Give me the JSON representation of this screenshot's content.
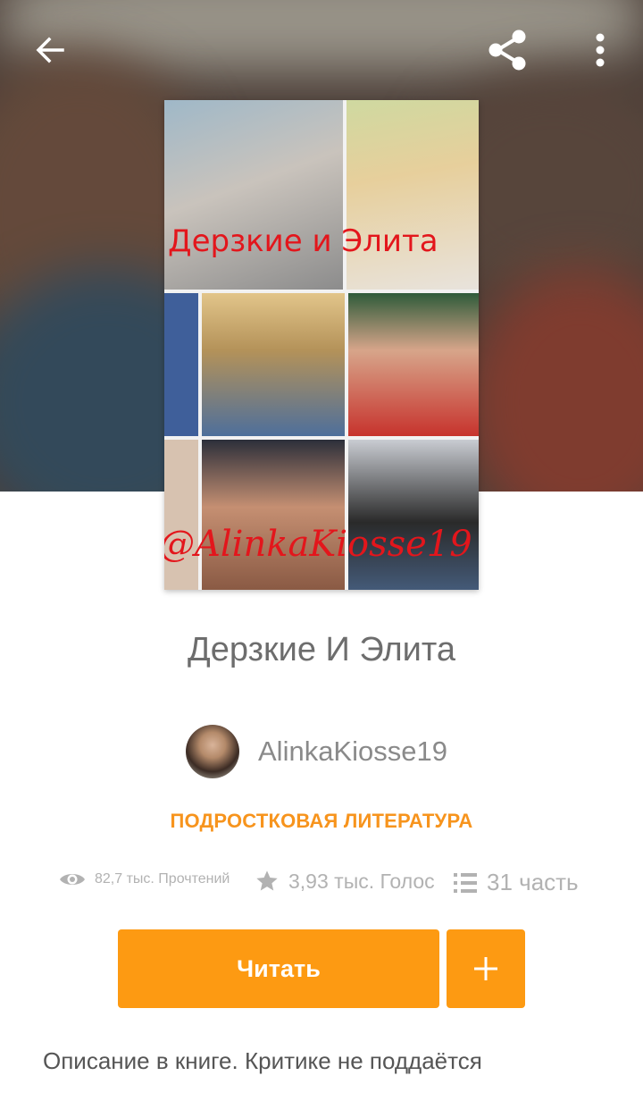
{
  "header": {
    "back_icon": "arrow-left-icon",
    "share_icon": "share-icon",
    "more_icon": "more-vertical-icon"
  },
  "cover": {
    "title_text": "Дерзкие и Элита",
    "author_text": "@AlinkaKiosse19"
  },
  "story": {
    "title": "Дерзкие И Элита",
    "author": "AlinkaKiosse19",
    "category": "ПОДРОСТКОВАЯ ЛИТЕРАТУРА"
  },
  "stats": {
    "reads": "82,7 тыс. Прочтений",
    "votes": "3,93 тыс. Голос",
    "parts": "31 часть"
  },
  "actions": {
    "read_label": "Читать",
    "add_icon": "plus-icon"
  },
  "description": "Описание в книге. Критике не поддаётся",
  "colors": {
    "accent": "#fd9a12",
    "category": "#f7941d",
    "cover_text": "#e3161c"
  }
}
